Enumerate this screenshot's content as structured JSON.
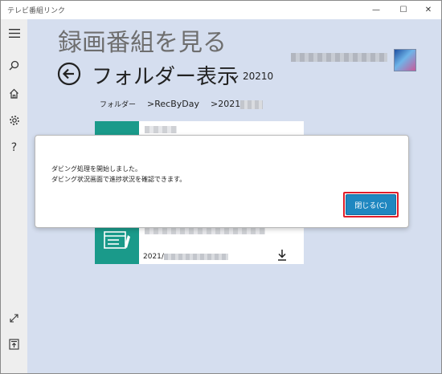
{
  "window": {
    "title": "テレビ番組リンク",
    "controls": {
      "minimize": "—",
      "maximize": "☐",
      "close": "✕"
    }
  },
  "sidebar": {
    "items": [
      {
        "name": "menu",
        "icon": "hamburger-icon"
      },
      {
        "name": "search",
        "icon": "search-icon"
      },
      {
        "name": "home",
        "icon": "home-icon"
      },
      {
        "name": "settings",
        "icon": "gear-icon"
      },
      {
        "name": "help",
        "icon": "help-icon",
        "label": "?"
      },
      {
        "name": "expand",
        "icon": "expand-icon"
      },
      {
        "name": "upload",
        "icon": "upload-icon"
      }
    ]
  },
  "header": {
    "page_title": "録画番組を見る",
    "folder_title": "フォルダー表示",
    "folder_sub": "20210"
  },
  "breadcrumbs": {
    "root": "フォルダー",
    "level1": ">RecByDay",
    "level2": ">2021"
  },
  "cards": {
    "date_prefix": "2021/"
  },
  "dialog": {
    "message_line1": "ダビング処理を開始しました。",
    "message_line2": "ダビング状況画面で進捗状況を確認できます。",
    "close_label": "閉じる(C)"
  },
  "colors": {
    "accent": "#1f87c0",
    "highlight": "#e01e2a",
    "thumbnail": "#1a9a8a",
    "background": "#d5deef"
  }
}
